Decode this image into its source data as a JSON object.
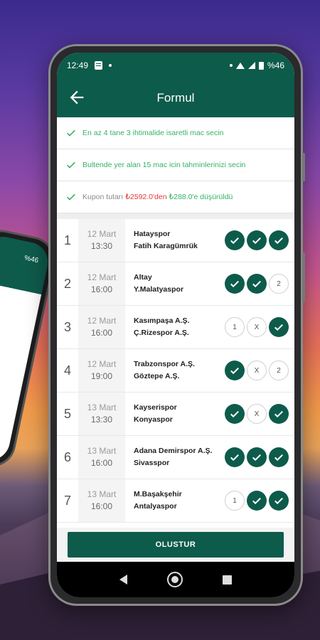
{
  "statusbar": {
    "time": "12:49",
    "battery": "%46"
  },
  "back_phone": {
    "battery": "%46"
  },
  "appbar": {
    "title": "Formul"
  },
  "info": {
    "line1": "En az 4 tane 3 ihtimalide isaretli mac secin",
    "line2": "Bultende yer alan 15 mac icin tahminlerinizi secin",
    "line3_prefix": "Kupon tutarı",
    "line3_old": "₺2592.0'den",
    "line3_new": "₺288.0'e düşürüldü"
  },
  "matches": [
    {
      "no": "1",
      "date": "12 Mart",
      "time": "13:30",
      "home": "Hatayspor",
      "away": "Fatih Karagümrük",
      "picks": [
        true,
        true,
        true
      ]
    },
    {
      "no": "2",
      "date": "12 Mart",
      "time": "16:00",
      "home": "Altay",
      "away": "Y.Malatyaspor",
      "picks": [
        true,
        true,
        false
      ]
    },
    {
      "no": "3",
      "date": "12 Mart",
      "time": "16:00",
      "home": "Kasımpaşa A.Ş.",
      "away": "Ç.Rizespor A.Ş.",
      "picks": [
        false,
        false,
        true
      ]
    },
    {
      "no": "4",
      "date": "12 Mart",
      "time": "19:00",
      "home": "Trabzonspor A.Ş.",
      "away": "Göztepe A.Ş.",
      "picks": [
        true,
        false,
        false
      ]
    },
    {
      "no": "5",
      "date": "13 Mart",
      "time": "13:30",
      "home": "Kayserispor",
      "away": "Konyaspor",
      "picks": [
        true,
        false,
        true
      ]
    },
    {
      "no": "6",
      "date": "13 Mart",
      "time": "16:00",
      "home": "Adana Demirspor A.Ş.",
      "away": "Sivasspor",
      "picks": [
        true,
        true,
        true
      ]
    },
    {
      "no": "7",
      "date": "13 Mart",
      "time": "16:00",
      "home": "M.Başakşehir",
      "away": "Antalyaspor",
      "picks": [
        false,
        true,
        true
      ]
    }
  ],
  "pick_labels": [
    "1",
    "X",
    "2"
  ],
  "button": {
    "label": "OLUSTUR"
  },
  "colors": {
    "primary": "#0d5b4b",
    "accent_green": "#35b068",
    "red": "#e53935"
  }
}
